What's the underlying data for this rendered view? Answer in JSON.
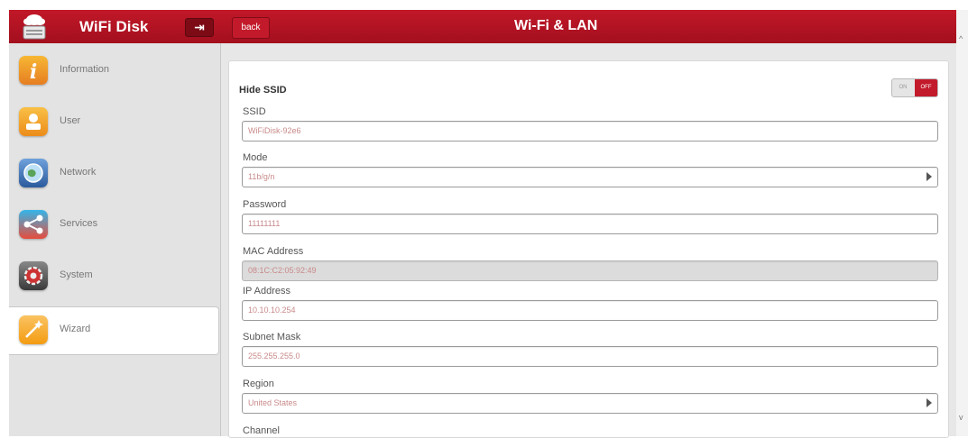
{
  "header": {
    "app_title": "WiFi Disk",
    "logout_glyph": "⇥",
    "back_label": "back",
    "page_title": "Wi-Fi & LAN",
    "accent_color": "#b7111f"
  },
  "sidebar": {
    "items": [
      {
        "label": "Information",
        "icon": "info-icon",
        "color": "#f39c12",
        "glyph": "i"
      },
      {
        "label": "User",
        "icon": "user-icon",
        "color": "#f5a623",
        "glyph": "👤"
      },
      {
        "label": "Network",
        "icon": "globe-icon",
        "color": "#3a6fb0",
        "glyph": "◎"
      },
      {
        "label": "Services",
        "icon": "share-icon",
        "color": "#2aa0d8",
        "glyph": "<"
      },
      {
        "label": "System",
        "icon": "system-gear-icon",
        "color": "#555555",
        "glyph": "✿"
      },
      {
        "label": "Wizard",
        "icon": "wizard-wand-icon",
        "color": "#f5a623",
        "glyph": "✦",
        "active": true
      }
    ]
  },
  "form": {
    "hide_ssid": {
      "label": "Hide SSID",
      "on_label": "ON",
      "off_label": "OFF",
      "state": "OFF"
    },
    "ssid": {
      "label": "SSID",
      "value": "WiFiDisk-92e6"
    },
    "mode": {
      "label": "Mode",
      "value": "11b/g/n"
    },
    "password": {
      "label": "Password",
      "value": "11111111"
    },
    "mac_address": {
      "label": "MAC Address",
      "value": "08:1C:C2:05:92:49"
    },
    "ip_address": {
      "label": "IP Address",
      "value": "10.10.10.254"
    },
    "subnet_mask": {
      "label": "Subnet Mask",
      "value": "255.255.255.0"
    },
    "region": {
      "label": "Region",
      "value": "United States"
    },
    "channel": {
      "label": "Channel"
    }
  },
  "scroll": {
    "up": "^",
    "down": "v"
  }
}
